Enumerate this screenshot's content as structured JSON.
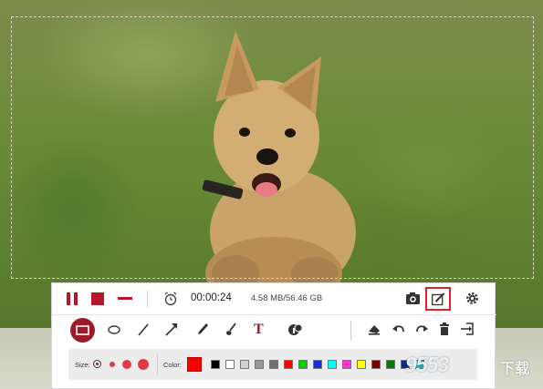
{
  "toolbar": {
    "timer": "00:00:24",
    "file_size": "4.58 MB/56.46 GB"
  },
  "drawing": {
    "text_tool_glyph": "T"
  },
  "style_bar": {
    "size_label": "Size:",
    "color_label": "Color:",
    "selected_color": "#ff0000",
    "palette": [
      "#000000",
      "#ffffff",
      "#cfcfcf",
      "#9a9a9a",
      "#6e6e6e",
      "#ff0000",
      "#00d000",
      "#1530d8",
      "#00ffff",
      "#ff33cc",
      "#ffff00",
      "#7a0000",
      "#0a7a0a",
      "#0b2a8c",
      "#1fb5b5"
    ]
  },
  "watermark": {
    "number": "9553",
    "text": "下载"
  },
  "colors": {
    "accent": "#b4192b",
    "highlight": "#e01f26"
  }
}
